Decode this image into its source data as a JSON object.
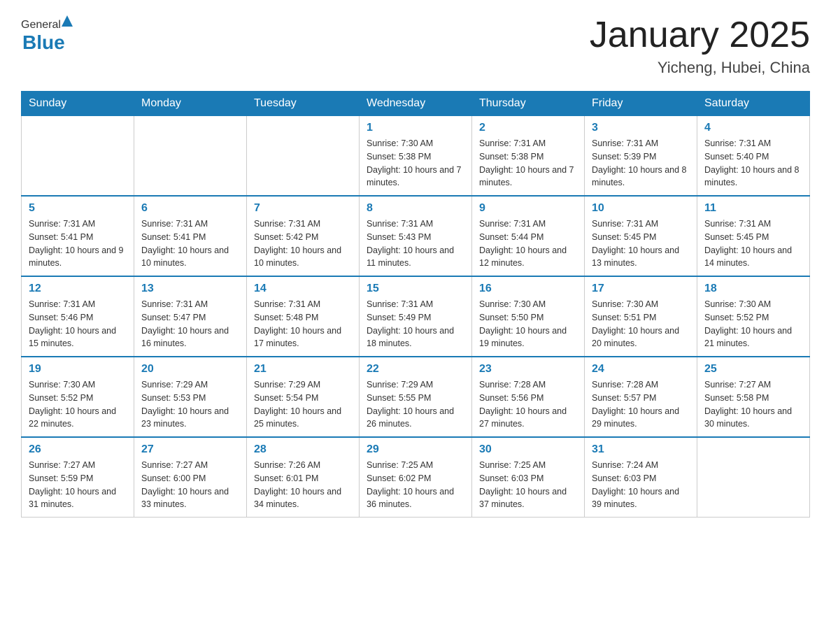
{
  "header": {
    "logo": {
      "general": "General",
      "blue": "Blue"
    },
    "title": "January 2025",
    "subtitle": "Yicheng, Hubei, China"
  },
  "calendar": {
    "days_of_week": [
      "Sunday",
      "Monday",
      "Tuesday",
      "Wednesday",
      "Thursday",
      "Friday",
      "Saturday"
    ],
    "weeks": [
      [
        {
          "day": "",
          "info": ""
        },
        {
          "day": "",
          "info": ""
        },
        {
          "day": "",
          "info": ""
        },
        {
          "day": "1",
          "info": "Sunrise: 7:30 AM\nSunset: 5:38 PM\nDaylight: 10 hours and 7 minutes."
        },
        {
          "day": "2",
          "info": "Sunrise: 7:31 AM\nSunset: 5:38 PM\nDaylight: 10 hours and 7 minutes."
        },
        {
          "day": "3",
          "info": "Sunrise: 7:31 AM\nSunset: 5:39 PM\nDaylight: 10 hours and 8 minutes."
        },
        {
          "day": "4",
          "info": "Sunrise: 7:31 AM\nSunset: 5:40 PM\nDaylight: 10 hours and 8 minutes."
        }
      ],
      [
        {
          "day": "5",
          "info": "Sunrise: 7:31 AM\nSunset: 5:41 PM\nDaylight: 10 hours and 9 minutes."
        },
        {
          "day": "6",
          "info": "Sunrise: 7:31 AM\nSunset: 5:41 PM\nDaylight: 10 hours and 10 minutes."
        },
        {
          "day": "7",
          "info": "Sunrise: 7:31 AM\nSunset: 5:42 PM\nDaylight: 10 hours and 10 minutes."
        },
        {
          "day": "8",
          "info": "Sunrise: 7:31 AM\nSunset: 5:43 PM\nDaylight: 10 hours and 11 minutes."
        },
        {
          "day": "9",
          "info": "Sunrise: 7:31 AM\nSunset: 5:44 PM\nDaylight: 10 hours and 12 minutes."
        },
        {
          "day": "10",
          "info": "Sunrise: 7:31 AM\nSunset: 5:45 PM\nDaylight: 10 hours and 13 minutes."
        },
        {
          "day": "11",
          "info": "Sunrise: 7:31 AM\nSunset: 5:45 PM\nDaylight: 10 hours and 14 minutes."
        }
      ],
      [
        {
          "day": "12",
          "info": "Sunrise: 7:31 AM\nSunset: 5:46 PM\nDaylight: 10 hours and 15 minutes."
        },
        {
          "day": "13",
          "info": "Sunrise: 7:31 AM\nSunset: 5:47 PM\nDaylight: 10 hours and 16 minutes."
        },
        {
          "day": "14",
          "info": "Sunrise: 7:31 AM\nSunset: 5:48 PM\nDaylight: 10 hours and 17 minutes."
        },
        {
          "day": "15",
          "info": "Sunrise: 7:31 AM\nSunset: 5:49 PM\nDaylight: 10 hours and 18 minutes."
        },
        {
          "day": "16",
          "info": "Sunrise: 7:30 AM\nSunset: 5:50 PM\nDaylight: 10 hours and 19 minutes."
        },
        {
          "day": "17",
          "info": "Sunrise: 7:30 AM\nSunset: 5:51 PM\nDaylight: 10 hours and 20 minutes."
        },
        {
          "day": "18",
          "info": "Sunrise: 7:30 AM\nSunset: 5:52 PM\nDaylight: 10 hours and 21 minutes."
        }
      ],
      [
        {
          "day": "19",
          "info": "Sunrise: 7:30 AM\nSunset: 5:52 PM\nDaylight: 10 hours and 22 minutes."
        },
        {
          "day": "20",
          "info": "Sunrise: 7:29 AM\nSunset: 5:53 PM\nDaylight: 10 hours and 23 minutes."
        },
        {
          "day": "21",
          "info": "Sunrise: 7:29 AM\nSunset: 5:54 PM\nDaylight: 10 hours and 25 minutes."
        },
        {
          "day": "22",
          "info": "Sunrise: 7:29 AM\nSunset: 5:55 PM\nDaylight: 10 hours and 26 minutes."
        },
        {
          "day": "23",
          "info": "Sunrise: 7:28 AM\nSunset: 5:56 PM\nDaylight: 10 hours and 27 minutes."
        },
        {
          "day": "24",
          "info": "Sunrise: 7:28 AM\nSunset: 5:57 PM\nDaylight: 10 hours and 29 minutes."
        },
        {
          "day": "25",
          "info": "Sunrise: 7:27 AM\nSunset: 5:58 PM\nDaylight: 10 hours and 30 minutes."
        }
      ],
      [
        {
          "day": "26",
          "info": "Sunrise: 7:27 AM\nSunset: 5:59 PM\nDaylight: 10 hours and 31 minutes."
        },
        {
          "day": "27",
          "info": "Sunrise: 7:27 AM\nSunset: 6:00 PM\nDaylight: 10 hours and 33 minutes."
        },
        {
          "day": "28",
          "info": "Sunrise: 7:26 AM\nSunset: 6:01 PM\nDaylight: 10 hours and 34 minutes."
        },
        {
          "day": "29",
          "info": "Sunrise: 7:25 AM\nSunset: 6:02 PM\nDaylight: 10 hours and 36 minutes."
        },
        {
          "day": "30",
          "info": "Sunrise: 7:25 AM\nSunset: 6:03 PM\nDaylight: 10 hours and 37 minutes."
        },
        {
          "day": "31",
          "info": "Sunrise: 7:24 AM\nSunset: 6:03 PM\nDaylight: 10 hours and 39 minutes."
        },
        {
          "day": "",
          "info": ""
        }
      ]
    ]
  }
}
